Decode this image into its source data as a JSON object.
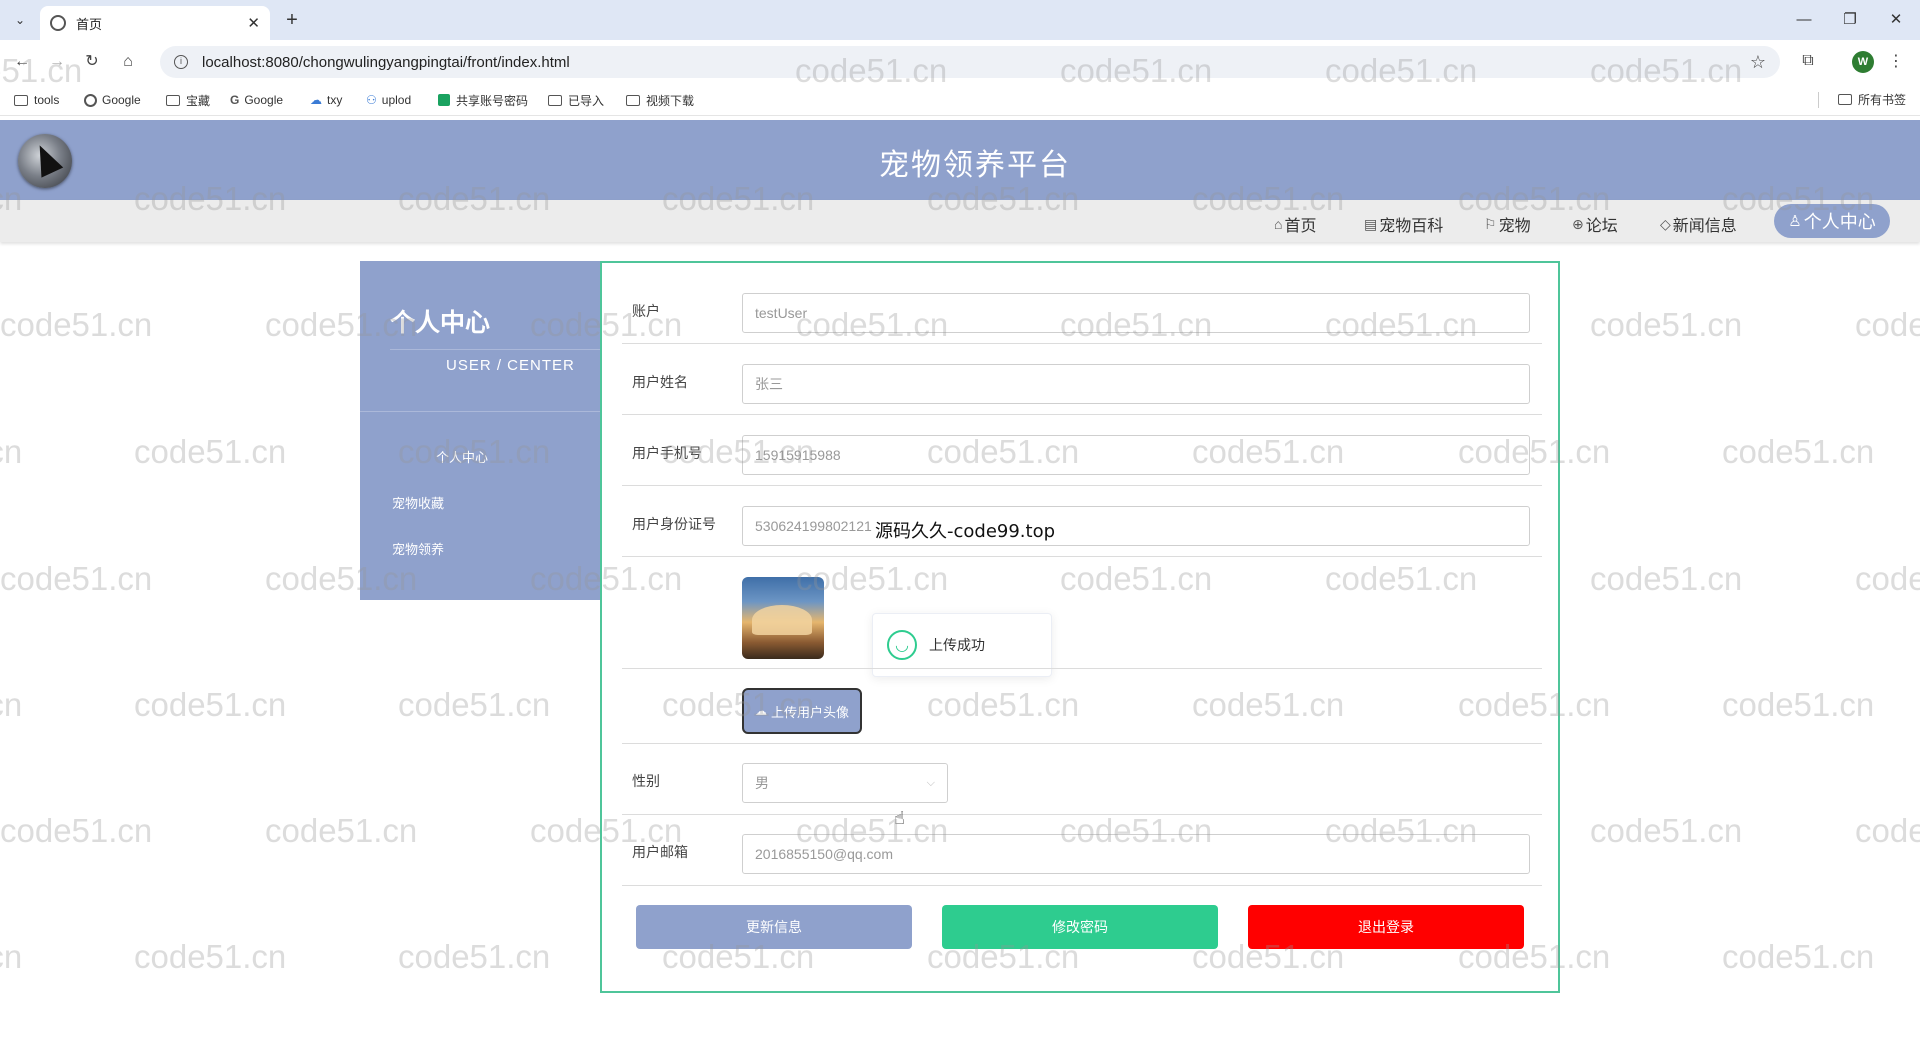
{
  "browser": {
    "tab_title": "首页",
    "url": "localhost:8080/chongwulingyangpingtai/front/index.html",
    "profile_initial": "W",
    "bookmarks": [
      "tools",
      "Google",
      "宝藏",
      "Google",
      "txy",
      "uplod",
      "共享账号密码",
      "已导入",
      "视频下载"
    ],
    "all_bookmarks": "所有书签"
  },
  "site": {
    "title": "宠物领养平台",
    "nav": [
      "首页",
      "宠物百科",
      "宠物",
      "论坛",
      "新闻信息"
    ],
    "nav_active": "个人中心"
  },
  "sidebar": {
    "title": "个人中心",
    "subtitle": "USER / CENTER",
    "items": [
      "个人中心",
      "宠物收藏",
      "宠物领养"
    ]
  },
  "form": {
    "account_label": "账户",
    "account_value": "testUser",
    "name_label": "用户姓名",
    "name_value": "张三",
    "phone_label": "用户手机号",
    "phone_value": "15915915988",
    "idcard_label": "用户身份证号",
    "idcard_value": "530624199802121",
    "upload_label": "上传用户头像",
    "gender_label": "性别",
    "gender_value": "男",
    "email_label": "用户邮箱",
    "email_value": "2016855150@qq.com",
    "update_btn": "更新信息",
    "password_btn": "修改密码",
    "logout_btn": "退出登录"
  },
  "toast": {
    "message": "上传成功"
  },
  "overlay_text": "源码久久-code99.top",
  "watermark_text": "code51.cn",
  "colors": {
    "header": "#8fa1cc",
    "panel_border": "#4fc59a",
    "password_btn": "#2ecc8f",
    "logout_btn": "#ff0000"
  }
}
